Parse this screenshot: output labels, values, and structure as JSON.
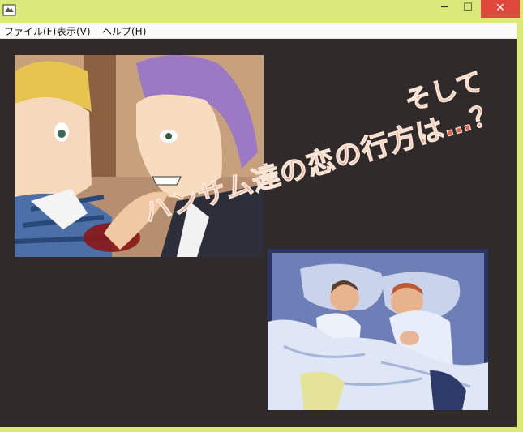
{
  "menu": {
    "file_label": "ファイル(F)",
    "view_label": "表示(V)",
    "help_label": "ヘルプ(H)"
  },
  "window_controls": {
    "minimize_glyph": "─",
    "maximize_glyph": "☐",
    "close_glyph": "✕"
  },
  "captions": {
    "line1": "そして",
    "line2": "ハンサム達の恋の行方は…？"
  },
  "colors": {
    "window_frame": "#d9ea7a",
    "client_background": "#312a2a",
    "caption_text": "#e7664b",
    "close_button": "#e0483d"
  }
}
